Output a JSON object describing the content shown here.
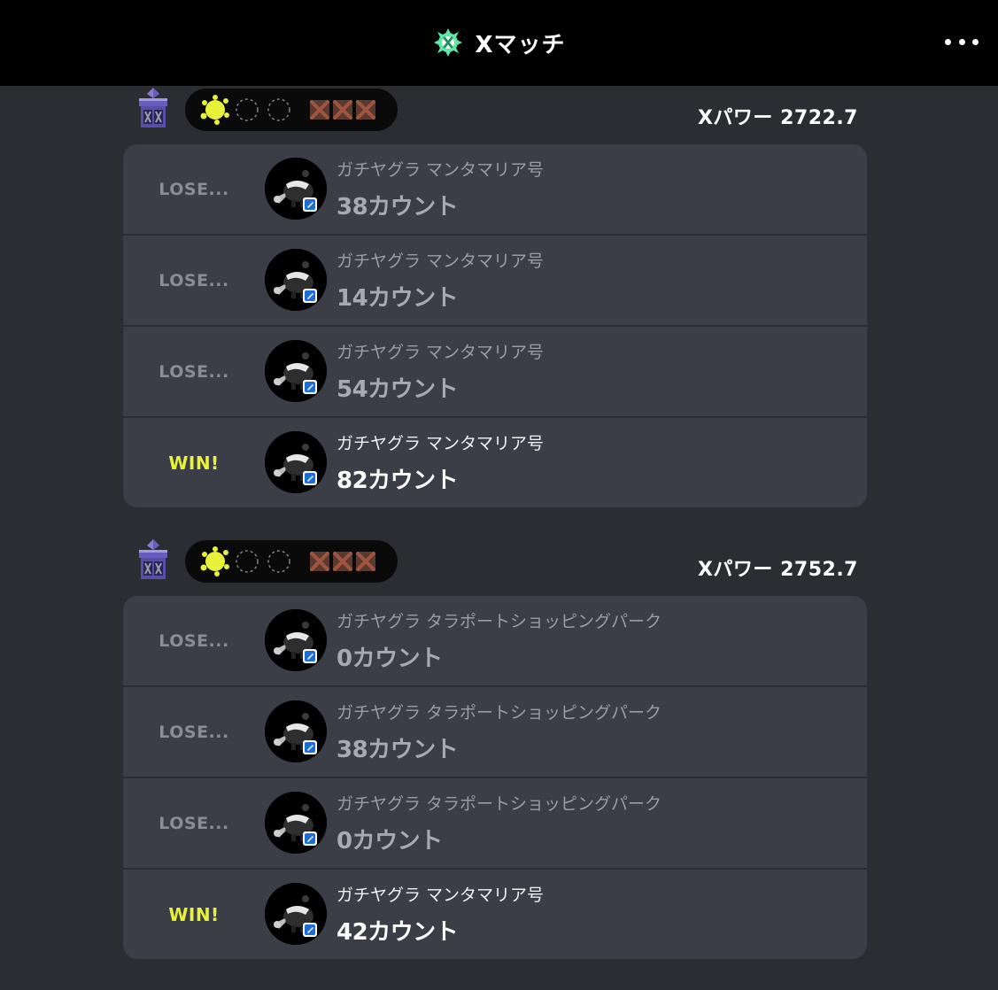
{
  "header": {
    "title": "Xマッチ",
    "icon": "x-match-emblem-icon",
    "menu_icon": "more-dots-icon",
    "colors": {
      "emblem": "#5ee8a8"
    }
  },
  "groups": [
    {
      "xpower": "Xパワー 2722.7",
      "record": {
        "wins": 1,
        "win_slots": 3,
        "losses": 3,
        "loss_slots": 3
      },
      "matches": [
        {
          "result": "LOSE...",
          "stage": "ガチヤグラ マンタマリア号",
          "count": "38カウント",
          "win": false
        },
        {
          "result": "LOSE...",
          "stage": "ガチヤグラ マンタマリア号",
          "count": "14カウント",
          "win": false
        },
        {
          "result": "LOSE...",
          "stage": "ガチヤグラ マンタマリア号",
          "count": "54カウント",
          "win": false
        },
        {
          "result": "WIN!",
          "stage": "ガチヤグラ マンタマリア号",
          "count": "82カウント",
          "win": true
        }
      ]
    },
    {
      "xpower": "Xパワー 2752.7",
      "record": {
        "wins": 1,
        "win_slots": 3,
        "losses": 3,
        "loss_slots": 3
      },
      "matches": [
        {
          "result": "LOSE...",
          "stage": "ガチヤグラ タラポートショッピングパーク",
          "count": "0カウント",
          "win": false
        },
        {
          "result": "LOSE...",
          "stage": "ガチヤグラ タラポートショッピングパーク",
          "count": "38カウント",
          "win": false
        },
        {
          "result": "LOSE...",
          "stage": "ガチヤグラ タラポートショッピングパーク",
          "count": "0カウント",
          "win": false
        },
        {
          "result": "WIN!",
          "stage": "ガチヤグラ マンタマリア号",
          "count": "42カウント",
          "win": true
        }
      ]
    }
  ],
  "colors": {
    "win": "#e8f23a",
    "lose": "#8a8d95",
    "card": "#3b3e46",
    "background": "#2b2d33",
    "loss_mark": "#8a4a3a"
  }
}
